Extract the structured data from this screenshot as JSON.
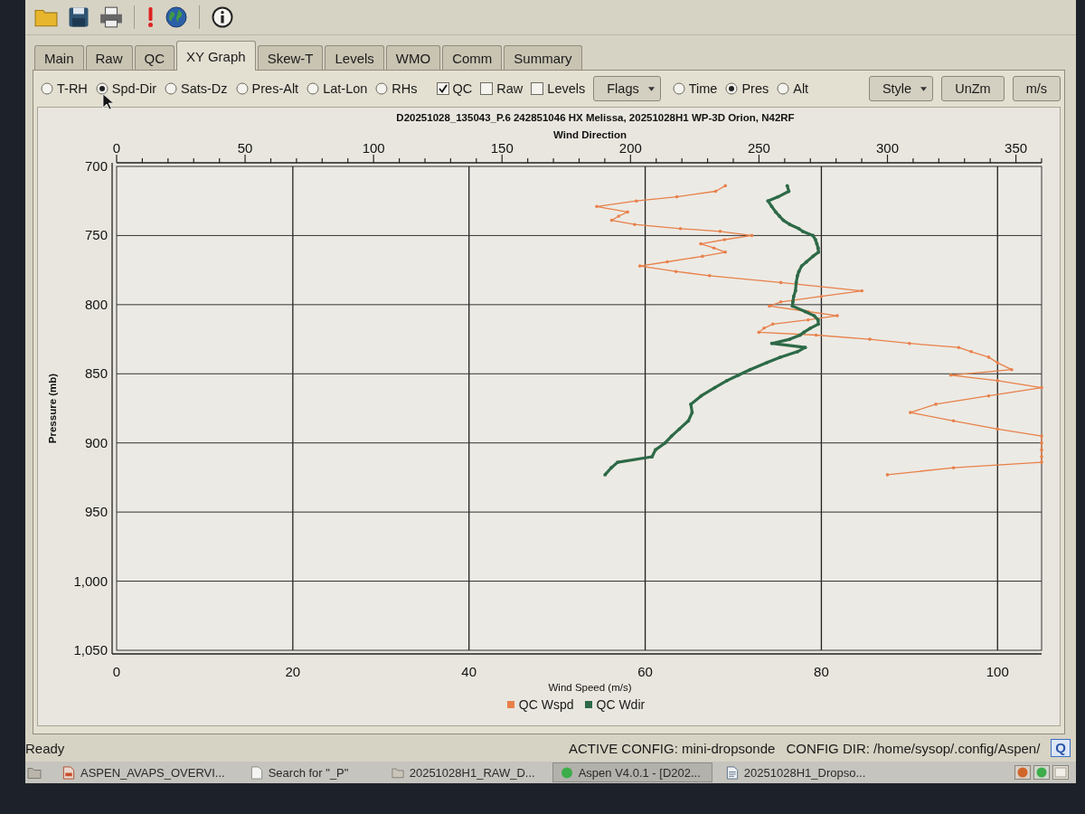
{
  "tabs": [
    {
      "label": "Main",
      "selected": false
    },
    {
      "label": "Raw",
      "selected": false
    },
    {
      "label": "QC",
      "selected": false
    },
    {
      "label": "XY Graph",
      "selected": true
    },
    {
      "label": "Skew-T",
      "selected": false
    },
    {
      "label": "Levels",
      "selected": false
    },
    {
      "label": "WMO",
      "selected": false
    },
    {
      "label": "Comm",
      "selected": false
    },
    {
      "label": "Summary",
      "selected": false
    }
  ],
  "plot_types": [
    {
      "label": "T-RH",
      "selected": false
    },
    {
      "label": "Spd-Dir",
      "selected": true
    },
    {
      "label": "Sats-Dz",
      "selected": false
    },
    {
      "label": "Pres-Alt",
      "selected": false
    },
    {
      "label": "Lat-Lon",
      "selected": false
    },
    {
      "label": "RHs",
      "selected": false
    }
  ],
  "data_filters": [
    {
      "label": "QC",
      "checked": true
    },
    {
      "label": "Raw",
      "checked": false
    },
    {
      "label": "Levels",
      "checked": false
    }
  ],
  "flags_menu": {
    "label": "Flags"
  },
  "vertical_axis": [
    {
      "label": "Time",
      "selected": false
    },
    {
      "label": "Pres",
      "selected": true
    },
    {
      "label": "Alt",
      "selected": false
    }
  ],
  "style_menu": {
    "label": "Style"
  },
  "buttons": [
    "UnZm",
    "m/s"
  ],
  "graph": {
    "chart_data": {
      "type": "line",
      "orientation": "horizontal",
      "grid": true,
      "title": "D20251028_135043_P.6 242851046 HX Melissa, 20251028H1 WP-3D Orion, N42RF",
      "xlabel": "Wind Speed (m/s)",
      "ylabel": "Pressure (mb)",
      "x2label": "Wind Direction",
      "xlim": [
        0,
        105
      ],
      "ylim": [
        1050,
        700
      ],
      "x2lim": [
        0,
        360
      ],
      "xticks": [
        0,
        20,
        40,
        60,
        80,
        100
      ],
      "yticks": [
        700,
        750,
        800,
        850,
        900,
        950,
        {
          "value": 1000,
          "label": "1,000"
        },
        {
          "value": 1050,
          "label": "1,050"
        }
      ],
      "x2ticks": [
        0,
        50,
        100,
        150,
        200,
        250,
        300,
        350
      ],
      "x": [
        714,
        718,
        722,
        725,
        729,
        733,
        736,
        739,
        742,
        745,
        747,
        750,
        753,
        756,
        759,
        762,
        765,
        769,
        772,
        776,
        779,
        784,
        790,
        794,
        798,
        801,
        805,
        808,
        811,
        814,
        817,
        820,
        822,
        825,
        828,
        831,
        834,
        838,
        842,
        847,
        851,
        855,
        860,
        866,
        872,
        878,
        884,
        890,
        895,
        900,
        905,
        910,
        914,
        918,
        923
      ],
      "series": [
        {
          "name": "QC Wspd",
          "color": "#e8804a",
          "values": [
            69.1,
            68.0,
            63.6,
            59.0,
            54.5,
            58.0,
            57.0,
            56.2,
            58.8,
            64.0,
            68.5,
            72.1,
            69.0,
            66.3,
            67.8,
            69.1,
            66.5,
            62.5,
            59.4,
            63.5,
            67.3,
            75.4,
            84.6,
            80.0,
            75.4,
            74.1,
            78.5,
            81.8,
            78.5,
            74.5,
            73.5,
            72.9,
            79.4,
            85.5,
            90.0,
            95.6,
            97.0,
            99.0,
            100.0,
            101.6,
            94.7,
            100.0,
            105.0,
            99.0,
            93.0,
            90.1,
            95.0,
            100.0,
            105.0,
            105.0,
            105.0,
            105.0,
            105.0,
            95.0,
            87.5
          ]
        },
        {
          "name": "QC Wdir",
          "color": "#2d6a47",
          "axis": "x2",
          "values": [
            261.0,
            261.6,
            257.5,
            253.5,
            255.0,
            256.5,
            258.0,
            259.5,
            262.0,
            265.5,
            267.0,
            271.0,
            272.0,
            272.5,
            273.0,
            273.2,
            271.0,
            268.5,
            266.6,
            265.5,
            265.0,
            264.5,
            264.2,
            263.5,
            263.2,
            263.0,
            268.0,
            271.5,
            273.0,
            273.1,
            270.0,
            267.5,
            266.0,
            262.0,
            255.0,
            268.0,
            265.0,
            258.3,
            253.0,
            246.5,
            242.0,
            237.5,
            232.8,
            227.5,
            223.5,
            224.0,
            222.5,
            219.0,
            216.0,
            213.5,
            209.7,
            208.4,
            195.0,
            192.5,
            190.1
          ]
        }
      ]
    }
  },
  "status_bar": {
    "message": "Ready",
    "active_config": "ACTIVE CONFIG: mini-dropsonde",
    "config_dir": "CONFIG DIR: /home/sysop/.config/Aspen/",
    "badge": "Q"
  },
  "taskbar": {
    "items": [
      {
        "kind": "pdf",
        "label": "ASPEN_AVAPS_OVERVI...",
        "selected": false
      },
      {
        "kind": "document",
        "label": "Search for \"_P\"",
        "selected": false
      },
      {
        "kind": "folder",
        "label": "20251028H1_RAW_D...",
        "selected": false
      },
      {
        "kind": "app",
        "label": "Aspen V4.0.1 - [D202...",
        "selected": true
      },
      {
        "kind": "text",
        "label": "20251028H1_Dropso...",
        "selected": false
      }
    ]
  }
}
